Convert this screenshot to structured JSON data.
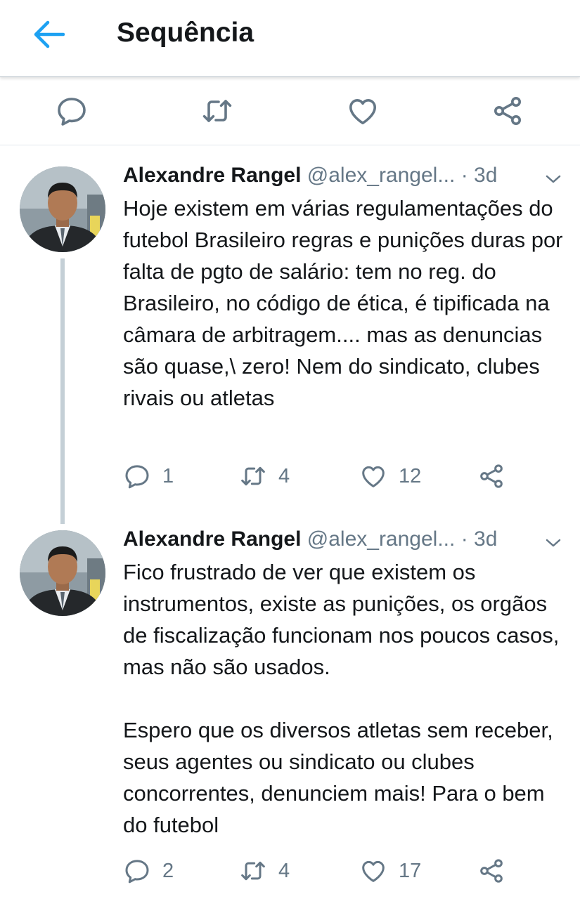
{
  "header": {
    "title": "Sequência"
  },
  "colors": {
    "accent": "#1da1f2",
    "icon_gray": "#657786",
    "text": "#14171a"
  },
  "action_bar": {
    "icons": [
      "reply-icon",
      "retweet-icon",
      "like-icon",
      "share-icon"
    ]
  },
  "tweets": [
    {
      "author": "Alexandre Rangel",
      "handle": "@alex_rangel...",
      "time": "· 3d",
      "paragraphs": [
        "Hoje existem em várias regulamentações do futebol Brasileiro regras e punições duras por falta de pgto de salário: tem no reg. do Brasileiro, no código de ética, é tipificada na câmara de arbitragem.... mas as denuncias são quase,\\ zero! Nem do sindicato, clubes rivais ou atletas"
      ],
      "replies": "1",
      "retweets": "4",
      "likes": "12"
    },
    {
      "author": "Alexandre Rangel",
      "handle": "@alex_rangel...",
      "time": "· 3d",
      "paragraphs": [
        "Fico frustrado de ver que existem os instrumentos, existe as punições, os orgãos de fiscalização funcionam nos poucos casos, mas não são usados.",
        "Espero que os diversos atletas sem receber, seus agentes ou sindicato ou clubes concorrentes, denunciem mais! Para o bem do futebol"
      ],
      "replies": "2",
      "retweets": "4",
      "likes": "17"
    }
  ]
}
